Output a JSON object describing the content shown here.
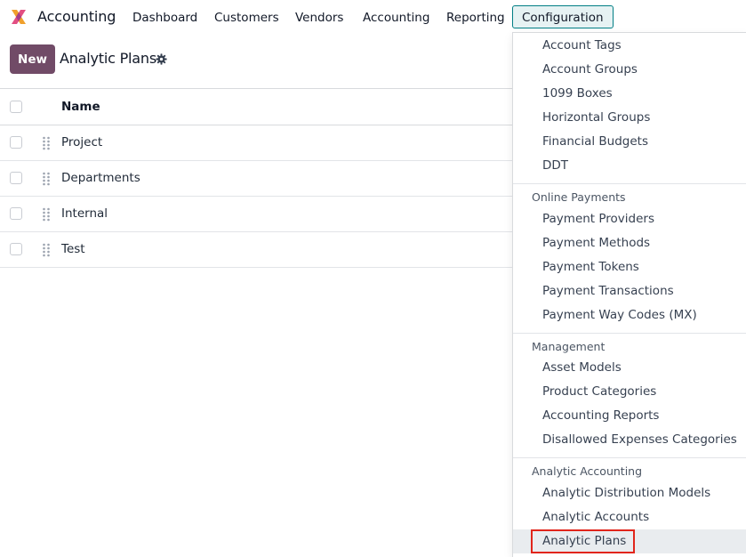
{
  "app": {
    "name": "Accounting",
    "logo_icon": "odoo-accounting-logo-icon"
  },
  "navbar": {
    "items": [
      {
        "label": "Dashboard"
      },
      {
        "label": "Customers"
      },
      {
        "label": "Vendors"
      },
      {
        "label": "Accounting"
      },
      {
        "label": "Reporting"
      },
      {
        "label": "Configuration",
        "active": true
      }
    ]
  },
  "control_panel": {
    "new_button": "New",
    "title": "Analytic Plans",
    "actions_icon": "gear-icon"
  },
  "list": {
    "columns": [
      "Name"
    ],
    "rows": [
      {
        "name": "Project"
      },
      {
        "name": "Departments"
      },
      {
        "name": "Internal"
      },
      {
        "name": "Test"
      }
    ]
  },
  "config_menu": {
    "top_items": [
      "Account Tags",
      "Account Groups",
      "1099 Boxes",
      "Horizontal Groups",
      "Financial Budgets",
      "DDT"
    ],
    "online_payments": {
      "title": "Online Payments",
      "items": [
        "Payment Providers",
        "Payment Methods",
        "Payment Tokens",
        "Payment Transactions",
        "Payment Way Codes (MX)"
      ]
    },
    "management": {
      "title": "Management",
      "items": [
        "Asset Models",
        "Product Categories",
        "Accounting Reports",
        "Disallowed Expenses Categories"
      ]
    },
    "analytic_accounting": {
      "title": "Analytic Accounting",
      "items": [
        "Analytic Distribution Models",
        "Analytic Accounts",
        "Analytic Plans"
      ]
    },
    "selected_item": "Analytic Plans"
  },
  "colors": {
    "brand": "#714b67",
    "active_menu_border": "#017e84",
    "active_menu_bg": "#e6f2f3",
    "highlight": "#e1251b"
  }
}
